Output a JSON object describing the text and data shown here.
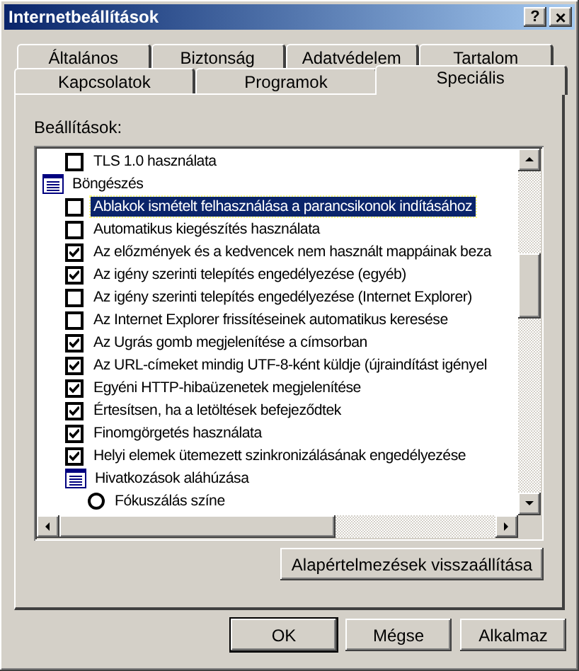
{
  "window": {
    "title": "Internetbeállítások",
    "help_button": "?",
    "close_button": "×"
  },
  "tab_rows": [
    [
      {
        "label": "Általános",
        "selected": false
      },
      {
        "label": "Biztonság",
        "selected": false
      },
      {
        "label": "Adatvédelem",
        "selected": false
      },
      {
        "label": "Tartalom",
        "selected": false
      }
    ],
    [
      {
        "label": "Kapcsolatok",
        "selected": false
      },
      {
        "label": "Programok",
        "selected": false
      },
      {
        "label": "Speciális",
        "selected": true
      }
    ]
  ],
  "settings_label": "Beállítások:",
  "settings": [
    {
      "kind": "group",
      "children": [
        {
          "kind": "checkbox",
          "label": "TLS 1.0 használata",
          "checked": false,
          "selected": false
        }
      ]
    },
    {
      "kind": "group",
      "label": "Böngészés",
      "children": [
        {
          "kind": "checkbox",
          "label": "Ablakok ismételt felhasználása a parancsikonok indításához",
          "checked": false,
          "selected": true
        },
        {
          "kind": "checkbox",
          "label": "Automatikus kiegészítés használata",
          "checked": false,
          "selected": false
        },
        {
          "kind": "checkbox",
          "label": "Az előzmények és a kedvencek nem használt mappáinak beza",
          "checked": true,
          "selected": false
        },
        {
          "kind": "checkbox",
          "label": "Az igény szerinti telepítés engedélyezése (egyéb)",
          "checked": true,
          "selected": false
        },
        {
          "kind": "checkbox",
          "label": "Az igény szerinti telepítés engedélyezése (Internet Explorer)",
          "checked": false,
          "selected": false
        },
        {
          "kind": "checkbox",
          "label": "Az Internet Explorer frissítéseinek automatikus keresése",
          "checked": false,
          "selected": false
        },
        {
          "kind": "checkbox",
          "label": "Az Ugrás gomb megjelenítése a címsorban",
          "checked": true,
          "selected": false
        },
        {
          "kind": "checkbox",
          "label": "Az URL-címeket mindig UTF-8-ként küldje (újraindítást igényel",
          "checked": true,
          "selected": false
        },
        {
          "kind": "checkbox",
          "label": "Egyéni HTTP-hibaüzenetek megjelenítése",
          "checked": true,
          "selected": false
        },
        {
          "kind": "checkbox",
          "label": "Értesítsen, ha a letöltések befejeződtek",
          "checked": true,
          "selected": false
        },
        {
          "kind": "checkbox",
          "label": "Finomgörgetés használata",
          "checked": true,
          "selected": false
        },
        {
          "kind": "checkbox",
          "label": "Helyi elemek ütemezett szinkronizálásának engedélyezése",
          "checked": true,
          "selected": false
        },
        {
          "kind": "group",
          "label": "Hivatkozások aláhúzása",
          "children": [
            {
              "kind": "radio",
              "label": "Fókuszálás színe",
              "checked": false,
              "selected": false
            }
          ]
        }
      ]
    }
  ],
  "restore_button": "Alapértelmezések visszaállítása",
  "buttons": [
    {
      "label": "OK",
      "default": true
    },
    {
      "label": "Mégse",
      "default": false
    },
    {
      "label": "Alkalmaz",
      "default": false
    }
  ]
}
